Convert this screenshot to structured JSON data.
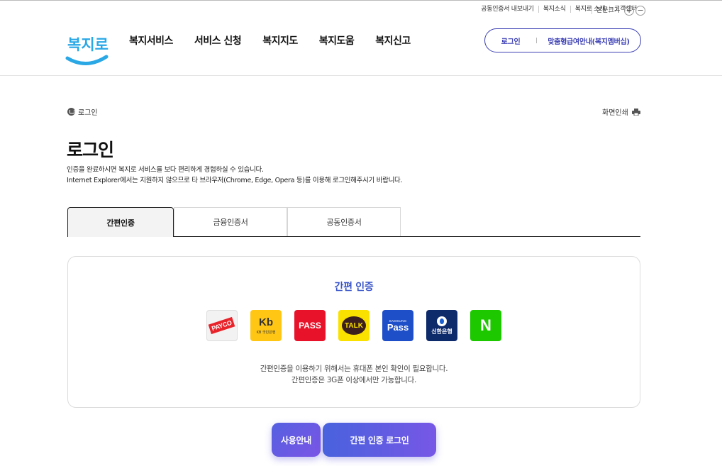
{
  "utility": {
    "items": [
      "공동인증서 내보내기",
      "복지소식",
      "복지로 소개",
      "고객센터"
    ],
    "font_label": "본문크기",
    "plus": "+",
    "minus": "−"
  },
  "logo": {
    "text": "복지로"
  },
  "gnb": [
    "복지서비스",
    "서비스 신청",
    "복지지도",
    "복지도움",
    "복지신고"
  ],
  "header_buttons": {
    "login": "로그인",
    "benefit": "맞춤형급여안내(복지멤버십)"
  },
  "breadcrumb": {
    "current": "로그인"
  },
  "print": {
    "label": "화면인쇄"
  },
  "page": {
    "title": "로그인",
    "desc_line1": "인증을 완료하시면 복지로 서비스를 보다 편리하게 경험하실 수 있습니다.",
    "desc_line2": "Internet Explorer에서는 지원하지 않으므로 타 브라우저(Chrome, Edge, Opera 등)를 이용해 로그인해주시기 바랍니다."
  },
  "tabs": [
    "간편인증",
    "금융인증서",
    "공동인증서"
  ],
  "active_tab": 0,
  "card": {
    "title": "간편 인증",
    "providers": {
      "payco": "PAYCO",
      "kb_mark": "Kb",
      "kb_text": "KB 국민은행",
      "pass": "PASS",
      "talk": "TALK",
      "samsung_small": "SAMSUNG",
      "samsung_big": "Pass",
      "shinhan": "신한은행",
      "naver": "N"
    },
    "desc_line1": "간편인증을 이용하기 위해서는 휴대폰 본인 확인이 필요합니다.",
    "desc_line2": "간편인증은 3G폰 이상에서만 가능합니다."
  },
  "buttons": {
    "guide": "사용안내",
    "login": "간편 인증 로그인"
  },
  "colors": {
    "accent": "#3b56c9",
    "brand_border": "#3b3fb3",
    "button_gradient_start": "#4862dd",
    "button_gradient_end": "#7757e6"
  }
}
